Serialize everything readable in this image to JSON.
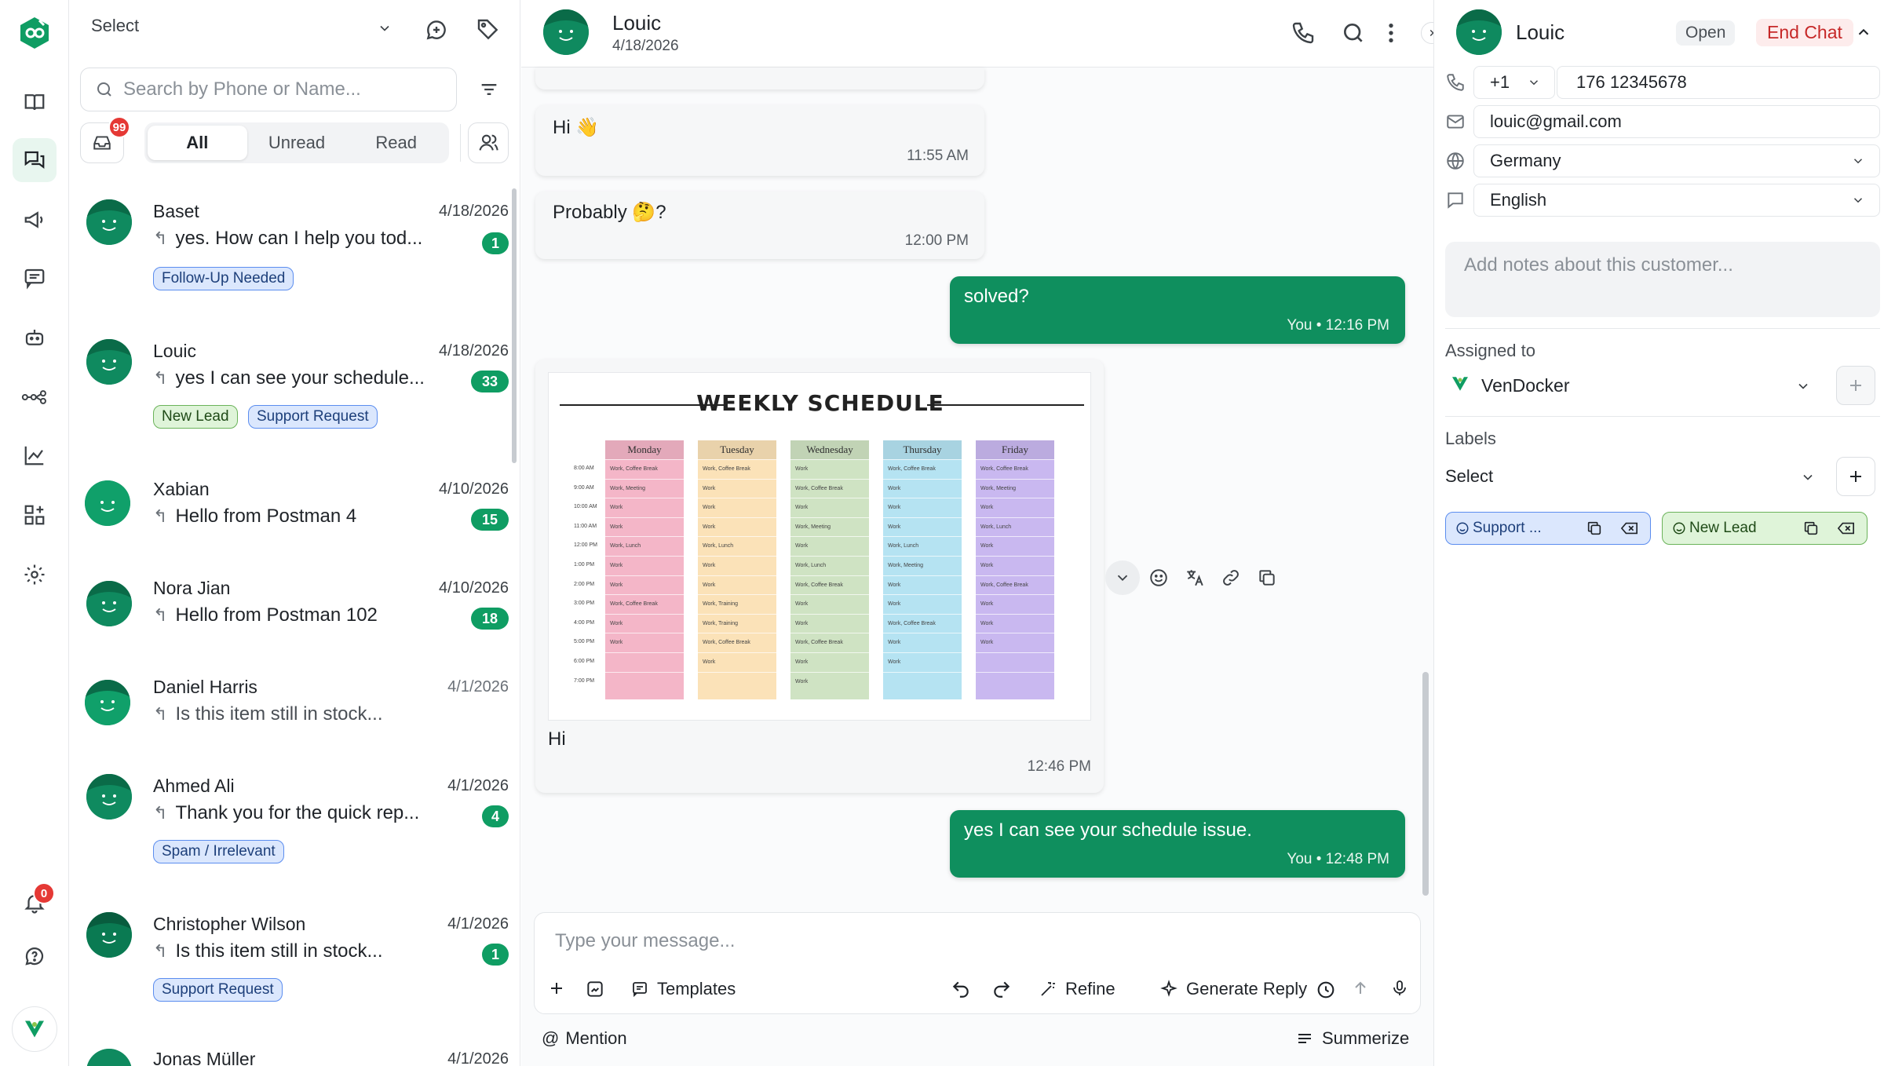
{
  "colors": {
    "brand_green": "#0f8f5e",
    "badge_red": "#e53935",
    "label_blue": "#dbe7fd",
    "label_green": "#dff4d9"
  },
  "rail": {
    "inbox_badge": "99",
    "notification_badge": "0",
    "icons": [
      "logo-icon",
      "knowledge-icon",
      "chats-icon",
      "campaign-icon",
      "comments-icon",
      "bot-icon",
      "workflow-icon",
      "analytics-icon",
      "integrations-icon",
      "settings-icon",
      "notification-icon",
      "help-icon",
      "vendocker-logo-icon"
    ]
  },
  "list": {
    "select_label": "Select",
    "search_placeholder": "Search by Phone or Name...",
    "filters": [
      "All",
      "Unread",
      "Read"
    ],
    "conversations": [
      {
        "name": "Baset",
        "date": "4/18/2026",
        "preview": "yes. How can I help you tod...",
        "count": "1",
        "tags": [
          {
            "text": "Follow-Up Needed",
            "color": "blue"
          }
        ],
        "read": false
      },
      {
        "name": "Louic",
        "date": "4/18/2026",
        "preview": "yes I can see your schedule...",
        "count": "33",
        "tags": [
          {
            "text": "New Lead",
            "color": "green"
          },
          {
            "text": "Support Request",
            "color": "blue"
          }
        ],
        "read": false
      },
      {
        "name": "Xabian",
        "date": "4/10/2026",
        "preview": "Hello from Postman 4",
        "count": "15",
        "tags": [],
        "read": false
      },
      {
        "name": "Nora Jian",
        "date": "4/10/2026",
        "preview": "Hello from Postman 102",
        "count": "18",
        "tags": [],
        "read": false
      },
      {
        "name": "Daniel Harris",
        "date": "4/1/2026",
        "preview": "Is this item still in stock...",
        "count": "",
        "tags": [],
        "read": true
      },
      {
        "name": "Ahmed Ali",
        "date": "4/1/2026",
        "preview": "Thank you for the quick rep...",
        "count": "4",
        "tags": [
          {
            "text": "Spam / Irrelevant",
            "color": "blue"
          }
        ],
        "read": false
      },
      {
        "name": "Christopher Wilson",
        "date": "4/1/2026",
        "preview": "Is this item still in stock...",
        "count": "1",
        "tags": [
          {
            "text": "Support Request",
            "color": "blue"
          }
        ],
        "read": false
      },
      {
        "name": "Jonas Müller",
        "date": "4/1/2026",
        "preview": "",
        "count": "",
        "tags": [],
        "read": false
      }
    ]
  },
  "chat": {
    "contact_name": "Louic",
    "contact_date": "4/18/2026",
    "messages": [
      {
        "dir": "in",
        "text": "Hi 👋",
        "time": "11:55 AM"
      },
      {
        "dir": "in",
        "text": "Probably 🤔?",
        "time": "12:00 PM"
      },
      {
        "dir": "out",
        "text": "solved?",
        "sender": "You",
        "time": "12:16 PM"
      },
      {
        "dir": "in",
        "text": "Hi",
        "time": "12:46 PM",
        "image": "weekly-schedule"
      },
      {
        "dir": "out",
        "text": "yes I can see your schedule issue.",
        "sender": "You",
        "time": "12:48 PM"
      }
    ],
    "schedule_image": {
      "title": "WEEKLY SCHEDULE",
      "days": [
        "Monday",
        "Tuesday",
        "Wednesday",
        "Thursday",
        "Friday"
      ],
      "day_colors": [
        "#f4b6c8",
        "#fbe2b8",
        "#cfe3c3",
        "#b5e3f2",
        "#c9b8f0"
      ],
      "times": [
        "8:00 AM",
        "9:00 AM",
        "10:00 AM",
        "11:00 AM",
        "12:00 PM",
        "1:00 PM",
        "2:00 PM",
        "3:00 PM",
        "4:00 PM",
        "5:00 PM",
        "6:00 PM",
        "7:00 PM"
      ],
      "cells": [
        [
          "Work, Coffee Break",
          "Work, Meeting",
          "Work",
          "Work",
          "Work, Lunch",
          "Work",
          "Work",
          "Work, Coffee Break",
          "Work",
          "Work",
          "",
          ""
        ],
        [
          "Work, Coffee Break",
          "Work",
          "Work",
          "Work",
          "Work, Lunch",
          "Work",
          "Work",
          "Work, Training",
          "Work, Training",
          "Work, Coffee Break",
          "Work",
          ""
        ],
        [
          "Work",
          "Work, Coffee Break",
          "Work",
          "Work, Meeting",
          "Work",
          "Work, Lunch",
          "Work, Coffee Break",
          "Work",
          "Work",
          "Work, Coffee Break",
          "Work",
          "Work"
        ],
        [
          "Work, Coffee Break",
          "Work",
          "Work",
          "Work",
          "Work, Lunch",
          "Work, Meeting",
          "Work",
          "Work",
          "Work, Coffee Break",
          "Work",
          "Work",
          ""
        ],
        [
          "Work, Coffee Break",
          "Work, Meeting",
          "Work",
          "Work, Lunch",
          "Work",
          "Work",
          "Work, Coffee Break",
          "Work",
          "Work",
          "Work",
          "",
          ""
        ]
      ]
    },
    "composer": {
      "placeholder": "Type your message...",
      "templates": "Templates",
      "refine": "Refine",
      "generate_reply": "Generate Reply",
      "mention": "Mention",
      "summarize": "Summerize"
    }
  },
  "side": {
    "name": "Louic",
    "status": "Open",
    "end_chat": "End Chat",
    "phone_code": "+1",
    "phone": "176 12345678",
    "email": "louic@gmail.com",
    "country": "Germany",
    "language": "English",
    "notes_placeholder": "Add notes about this customer...",
    "assigned_label": "Assigned to",
    "assignee": "VenDocker",
    "labels_label": "Labels",
    "labels_select": "Select",
    "labels": [
      {
        "text": "Support ...",
        "color": "blue"
      },
      {
        "text": "New Lead",
        "color": "green"
      }
    ]
  }
}
